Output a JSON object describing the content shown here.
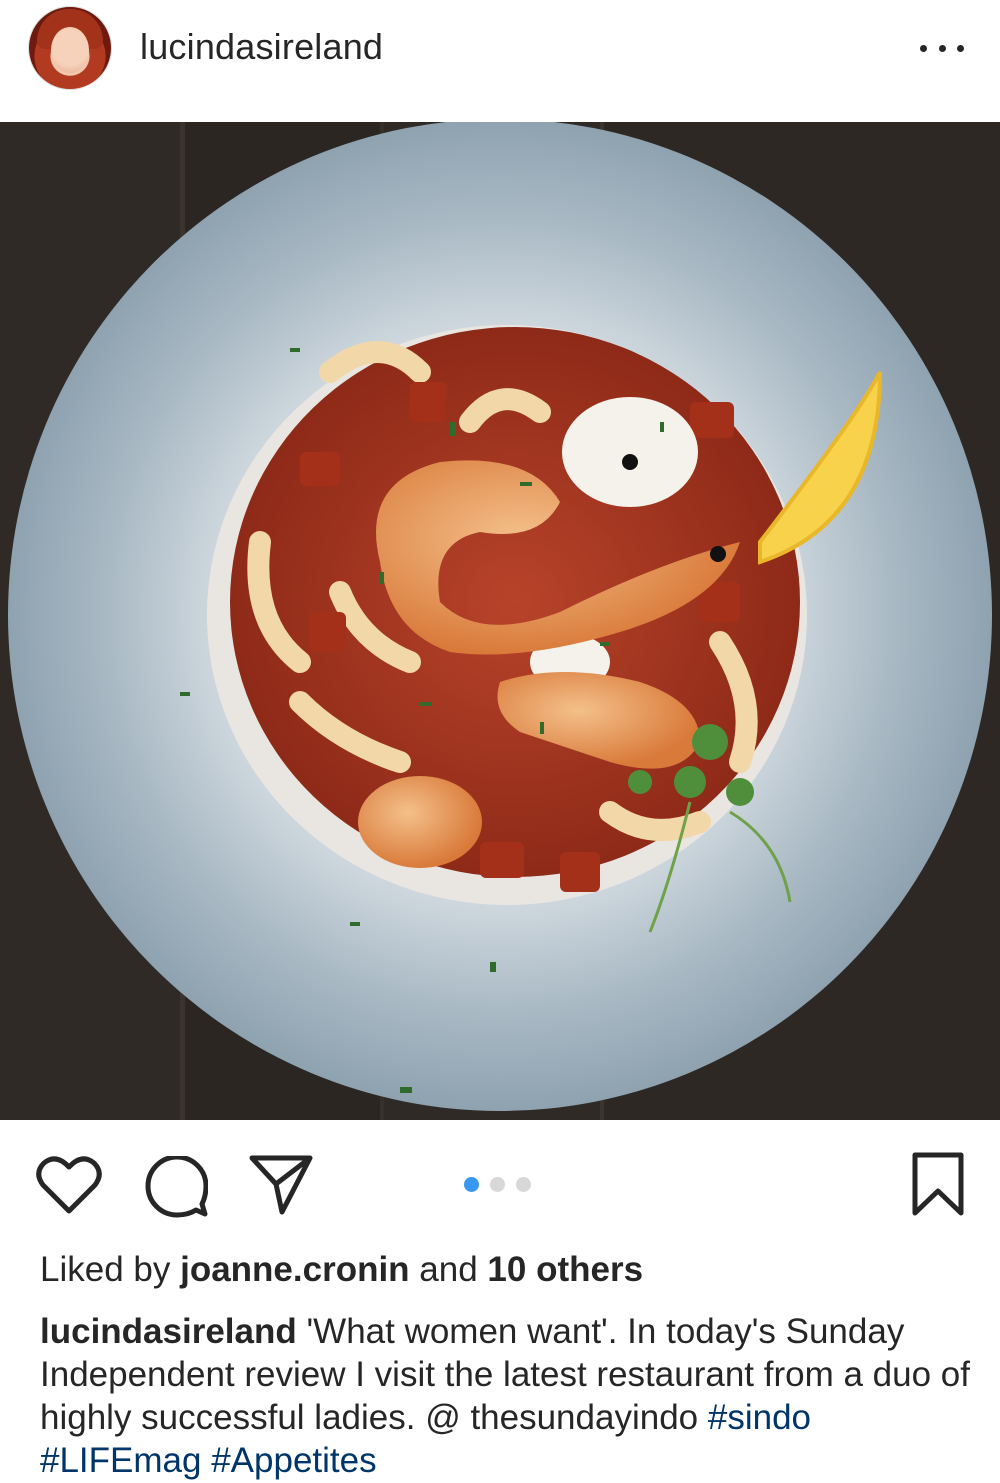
{
  "post": {
    "username": "lucindasireland",
    "more_icon": "more-horizontal-icon",
    "image_description_icon": "food-photo"
  },
  "actions": {
    "like_icon": "heart-icon",
    "comment_icon": "comment-icon",
    "share_icon": "paper-plane-icon",
    "save_icon": "bookmark-icon",
    "carousel_total": 3,
    "carousel_active": 1
  },
  "likes": {
    "prefix": "Liked by ",
    "liker": "joanne.cronin",
    "middle": " and ",
    "others": "10 others"
  },
  "caption": {
    "username": "lucindasireland",
    "text": " 'What women want'. In today's Sunday Independent review I visit the latest restaurant from a duo of highly successful ladies. @ thesundayindo ",
    "hashtags": [
      "#sindo",
      "#LIFEmag",
      "#Appetites"
    ]
  },
  "colors": {
    "text": "#262626",
    "hashtag": "#003569",
    "carousel_active": "#3897f0",
    "carousel_inactive": "#d8d8d8"
  }
}
